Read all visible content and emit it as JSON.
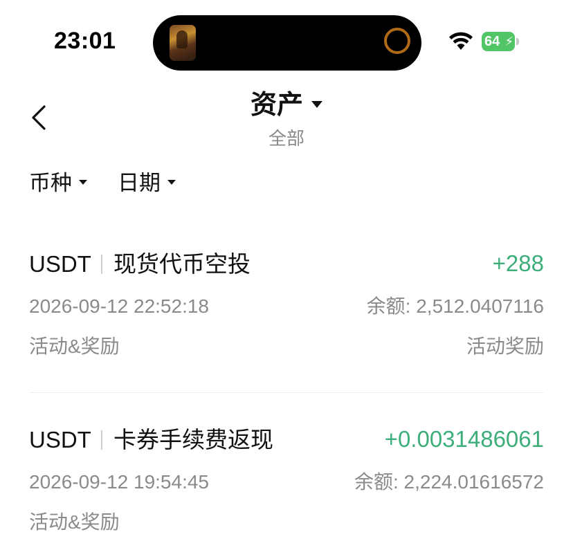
{
  "status_bar": {
    "time": "23:01",
    "battery": "64",
    "icons": [
      "wifi-icon",
      "battery-icon",
      "charging-bolt-icon"
    ]
  },
  "header": {
    "title": "资产",
    "subtitle": "全部",
    "back_icon": "chevron-left-icon",
    "title_dropdown_icon": "caret-down-icon"
  },
  "filters": [
    {
      "label": "币种",
      "icon": "caret-down-icon"
    },
    {
      "label": "日期",
      "icon": "caret-down-icon"
    }
  ],
  "records": [
    {
      "coin": "USDT",
      "type": "现货代币空投",
      "amount": "+288",
      "time": "2026-09-12 22:52:18",
      "balance": "余额: 2,512.0407116",
      "category": "活动&奖励",
      "source": "活动奖励"
    },
    {
      "coin": "USDT",
      "type": "卡券手续费返现",
      "amount": "+0.0031486061",
      "time": "2026-09-12 19:54:45",
      "balance": "余额: 2,224.01616572",
      "category": "活动&奖励",
      "source": ""
    }
  ],
  "colors": {
    "positive": "#3dae79",
    "secondary_text": "#8a8a8a",
    "battery": "#52c566"
  }
}
